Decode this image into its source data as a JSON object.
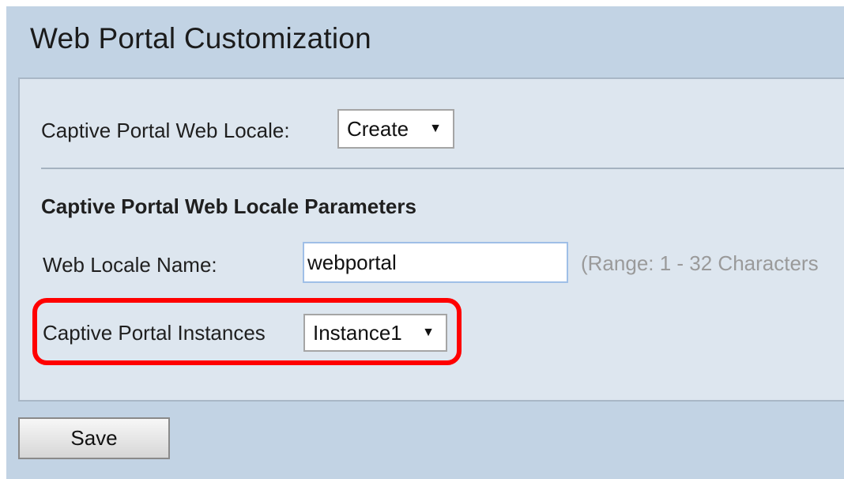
{
  "page": {
    "title": "Web Portal Customization"
  },
  "locale": {
    "label": "Captive Portal Web Locale:",
    "selected": "Create"
  },
  "parameters": {
    "heading": "Captive Portal Web Locale Parameters",
    "name_label": "Web Locale Name:",
    "name_value": "webportal",
    "name_hint": "(Range: 1 - 32 Characters",
    "instances_label": "Captive Portal Instances",
    "instances_selected": "Instance1"
  },
  "actions": {
    "save_label": "Save"
  },
  "colors": {
    "background": "#c2d3e4",
    "panel": "#dde6ef",
    "highlight": "#ff0000",
    "input_focus_border": "#9fbfe7"
  },
  "icons": {
    "dropdown": "triangle-down-icon"
  }
}
